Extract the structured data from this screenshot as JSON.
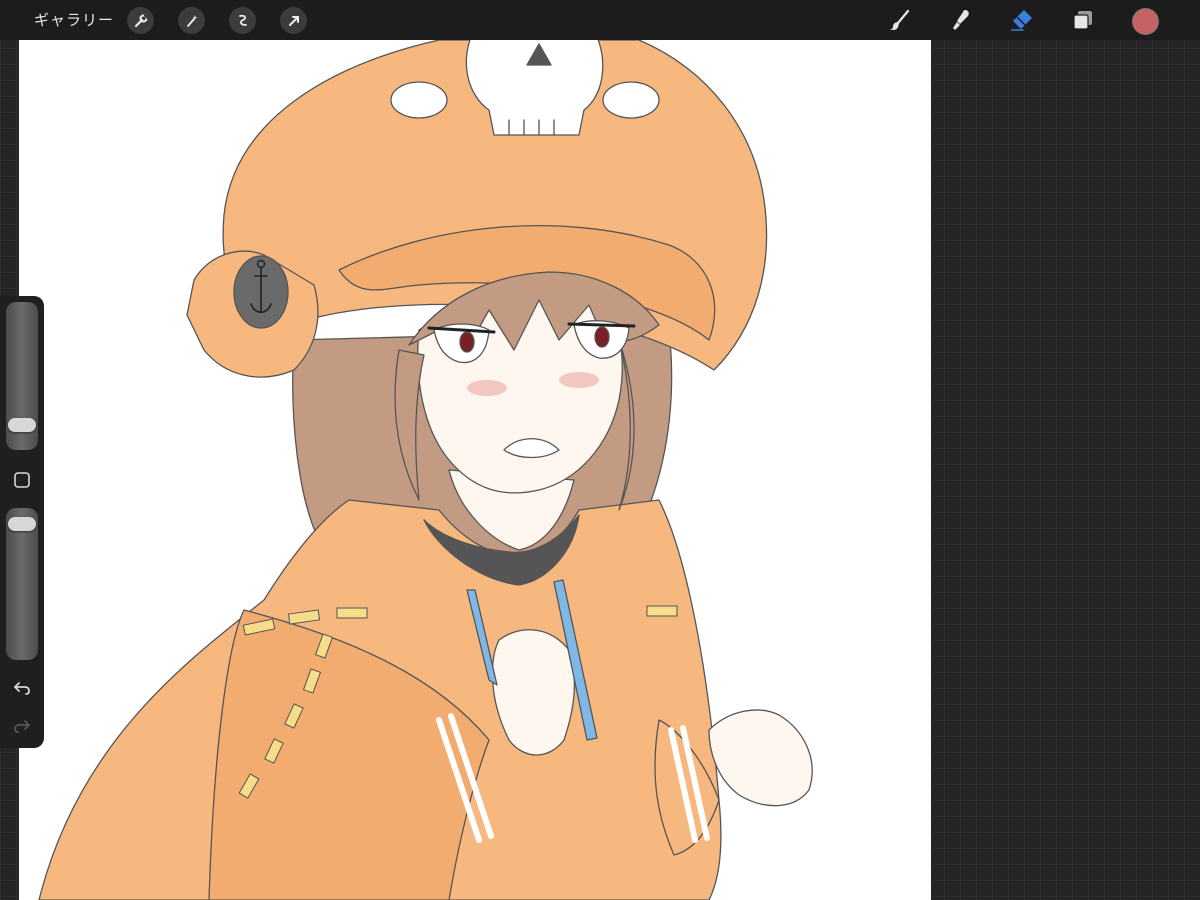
{
  "topbar": {
    "gallery_label": "ギャラリー",
    "left_tools": [
      "wrench-icon",
      "magic-wand-icon",
      "selection-icon",
      "transform-icon"
    ],
    "right_tools": [
      "brush-icon",
      "smudge-icon",
      "eraser-icon",
      "layers-icon"
    ],
    "active_tool": "eraser",
    "active_color": "#c56364"
  },
  "sidebar": {
    "brush_size_level": 0.12,
    "opacity_level": 0.95,
    "buttons": [
      "modify-square-icon",
      "undo-icon",
      "redo-icon"
    ]
  },
  "colors": {
    "app_background": "#252525",
    "toolbar_background": "#1c1c1c",
    "active_tool_accent": "#3a7fe0",
    "canvas": "#ffffff",
    "hoodie_orange": "#f7b880",
    "hair_brown": "#c39b83",
    "drawstring_blue": "#7fb8e6"
  },
  "canvas": {
    "artwork": "character-sketch"
  }
}
